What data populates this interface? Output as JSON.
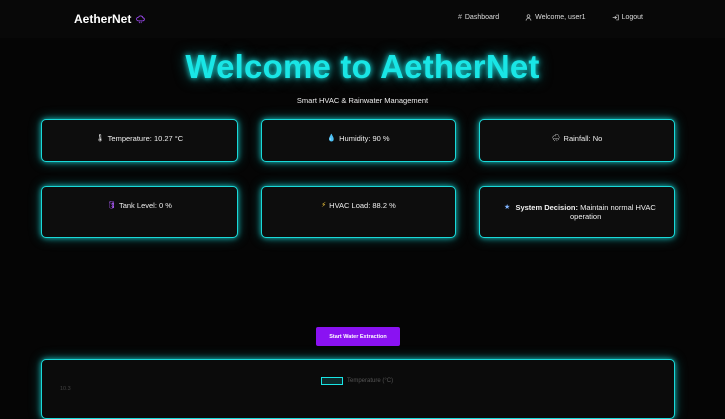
{
  "nav": {
    "brand": "AetherNet",
    "links": [
      {
        "icon": "dashboard-icon",
        "label": "Dashboard"
      },
      {
        "icon": "user-icon",
        "label": "Welcome, user1"
      },
      {
        "icon": "logout-icon",
        "label": "Logout"
      }
    ]
  },
  "hero": {
    "title": "Welcome to AetherNet",
    "subtitle": "Smart HVAC & Rainwater Management"
  },
  "cards": {
    "temperature": {
      "icon": "thermometer-icon",
      "label": "Temperature: 10.27 °C"
    },
    "humidity": {
      "icon": "droplet-icon",
      "label": "Humidity: 90 %"
    },
    "rainfall": {
      "icon": "rain-cloud-icon",
      "label": "Rainfall: No"
    },
    "tank": {
      "icon": "tank-icon",
      "label": "Tank Level: 0 %"
    },
    "hvac": {
      "icon": "lightning-icon",
      "label": "HVAC Load: 88.2 %"
    },
    "decision": {
      "icon": "star-icon",
      "label_bold": "System Decision:",
      "label": "Maintain normal HVAC operation"
    }
  },
  "actions": {
    "extract_button": "Start Water Extraction"
  },
  "chart": {
    "legend": "Temperature (°C)",
    "y_tick_top": "10.3"
  },
  "colors": {
    "accent": "#19e6e6",
    "button": "#8a12f2",
    "background": "#050505"
  }
}
